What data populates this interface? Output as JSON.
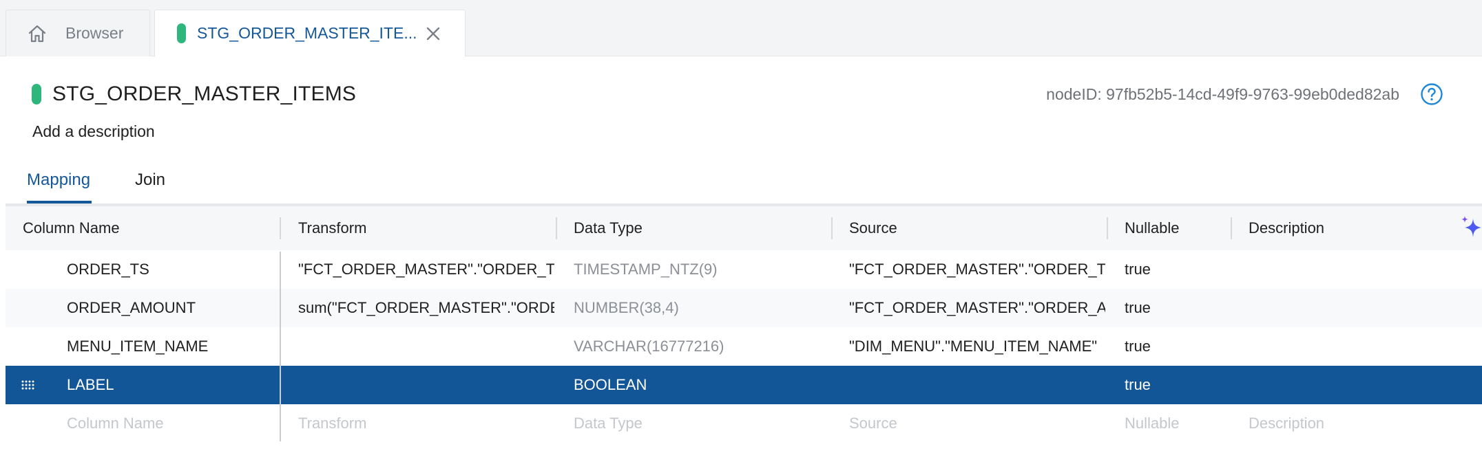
{
  "tabs": {
    "browser_label": "Browser",
    "active_label": "STG_ORDER_MASTER_ITE..."
  },
  "node": {
    "title": "STG_ORDER_MASTER_ITEMS",
    "node_id": "nodeID: 97fb52b5-14cd-49f9-9763-99eb0ded82ab",
    "description_placeholder": "Add a description",
    "status_color": "#2fb67c"
  },
  "subtabs": [
    "Mapping",
    "Join"
  ],
  "grid": {
    "headers": {
      "column_name": "Column Name",
      "transform": "Transform",
      "data_type": "Data Type",
      "source": "Source",
      "nullable": "Nullable",
      "description": "Description"
    },
    "rows": [
      {
        "name": "ORDER_TS",
        "transform": "\"FCT_ORDER_MASTER\".\"ORDER_TS\"::d",
        "data_type": "TIMESTAMP_NTZ(9)",
        "source": "\"FCT_ORDER_MASTER\".\"ORDER_TS\"",
        "nullable": "true",
        "description": ""
      },
      {
        "name": "ORDER_AMOUNT",
        "transform": "sum(\"FCT_ORDER_MASTER\".\"ORDER_A",
        "data_type": "NUMBER(38,4)",
        "source": "\"FCT_ORDER_MASTER\".\"ORDER_AMOU",
        "nullable": "true",
        "description": ""
      },
      {
        "name": "MENU_ITEM_NAME",
        "transform": "",
        "data_type": "VARCHAR(16777216)",
        "source": "\"DIM_MENU\".\"MENU_ITEM_NAME\"",
        "nullable": "true",
        "description": ""
      },
      {
        "name": "LABEL",
        "transform": "",
        "data_type": "BOOLEAN",
        "source": "",
        "nullable": "true",
        "description": ""
      }
    ],
    "placeholders": {
      "column_name": "Column Name",
      "transform": "Transform",
      "data_type": "Data Type",
      "source": "Source",
      "nullable": "Nullable",
      "description": "Description"
    }
  },
  "colors": {
    "accent": "#14589a",
    "selected_row": "#135697",
    "status_green": "#2fb67c"
  },
  "icons": {
    "home": "home-icon",
    "close": "close-icon",
    "help": "help-circle-icon",
    "drag": "drag-handle-icon",
    "ai": "sparkle-icon"
  }
}
